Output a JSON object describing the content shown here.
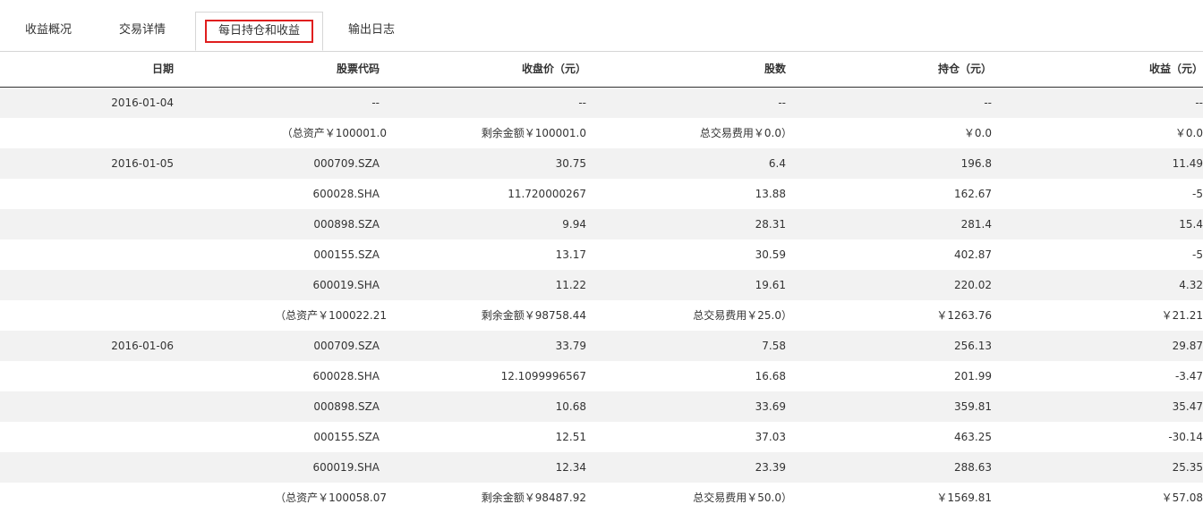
{
  "tabs": [
    {
      "label": "收益概况",
      "active": false
    },
    {
      "label": "交易详情",
      "active": false
    },
    {
      "label": "每日持仓和收益",
      "active": true
    },
    {
      "label": "输出日志",
      "active": false
    }
  ],
  "columns": [
    "日期",
    "股票代码",
    "收盘价（元）",
    "股数",
    "持仓（元）",
    "收益（元）"
  ],
  "rows": [
    {
      "date": "2016-01-04",
      "code": "--",
      "close": "--",
      "shares": "--",
      "position": "--",
      "profit": "--"
    },
    {
      "date": "",
      "code": "（总资产￥100001.0",
      "close": "剩余金额￥100001.0",
      "shares": "总交易费用￥0.0）",
      "position": "￥0.0",
      "profit": "￥0.0",
      "summary": true
    },
    {
      "date": "2016-01-05",
      "code": "000709.SZA",
      "close": "30.75",
      "shares": "6.4",
      "position": "196.8",
      "profit": "11.49"
    },
    {
      "date": "",
      "code": "600028.SHA",
      "close": "11.720000267",
      "shares": "13.88",
      "position": "162.67",
      "profit": "-5"
    },
    {
      "date": "",
      "code": "000898.SZA",
      "close": "9.94",
      "shares": "28.31",
      "position": "281.4",
      "profit": "15.4"
    },
    {
      "date": "",
      "code": "000155.SZA",
      "close": "13.17",
      "shares": "30.59",
      "position": "402.87",
      "profit": "-5"
    },
    {
      "date": "",
      "code": "600019.SHA",
      "close": "11.22",
      "shares": "19.61",
      "position": "220.02",
      "profit": "4.32"
    },
    {
      "date": "",
      "code": "（总资产￥100022.21",
      "close": "剩余金额￥98758.44",
      "shares": "总交易费用￥25.0）",
      "position": "￥1263.76",
      "profit": "￥21.21",
      "summary": true
    },
    {
      "date": "2016-01-06",
      "code": "000709.SZA",
      "close": "33.79",
      "shares": "7.58",
      "position": "256.13",
      "profit": "29.87"
    },
    {
      "date": "",
      "code": "600028.SHA",
      "close": "12.1099996567",
      "shares": "16.68",
      "position": "201.99",
      "profit": "-3.47"
    },
    {
      "date": "",
      "code": "000898.SZA",
      "close": "10.68",
      "shares": "33.69",
      "position": "359.81",
      "profit": "35.47"
    },
    {
      "date": "",
      "code": "000155.SZA",
      "close": "12.51",
      "shares": "37.03",
      "position": "463.25",
      "profit": "-30.14"
    },
    {
      "date": "",
      "code": "600019.SHA",
      "close": "12.34",
      "shares": "23.39",
      "position": "288.63",
      "profit": "25.35"
    },
    {
      "date": "",
      "code": "（总资产￥100058.07",
      "close": "剩余金额￥98487.92",
      "shares": "总交易费用￥50.0）",
      "position": "￥1569.81",
      "profit": "￥57.08",
      "summary": true
    }
  ]
}
